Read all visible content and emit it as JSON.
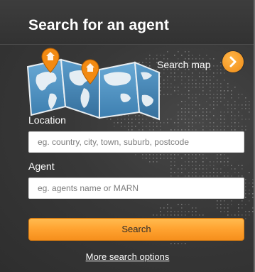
{
  "widget": {
    "title": "Search for an agent"
  },
  "map_section": {
    "search_map_label": "Search map",
    "button_icon": "chevron-right-icon",
    "map_icon": "folded-world-map-icon",
    "pin_icon": "home-pin-icon"
  },
  "form": {
    "location": {
      "label": "Location",
      "placeholder": "eg. country, city, town, suburb, postcode",
      "value": ""
    },
    "agent": {
      "label": "Agent",
      "placeholder": "eg. agents name or MARN",
      "value": ""
    },
    "search_button_label": "Search",
    "more_options_link": "More search options"
  },
  "colors": {
    "panel_background": "#3a3a3a",
    "accent_orange": "#f7961f",
    "text_white": "#ffffff",
    "map_blue": "#4a8fbe"
  }
}
